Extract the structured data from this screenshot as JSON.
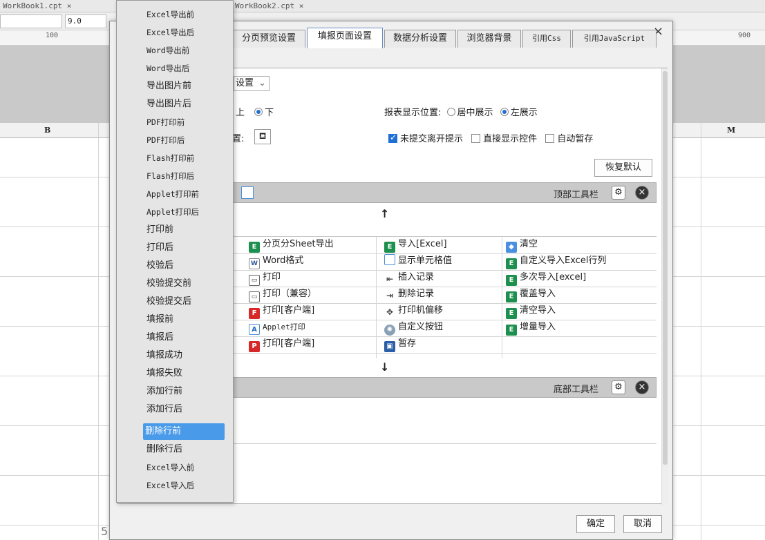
{
  "topbar": {
    "tab1": "WorkBook1.cpt ×",
    "tab2": "WorkBook2.cpt ×"
  },
  "format_bar": {
    "font_size": "9.0"
  },
  "ruler": {
    "mark_left": "100",
    "mark_right": "900"
  },
  "columns": {
    "b": "B",
    "m": "M"
  },
  "row_number_partial": "5",
  "dialog": {
    "close": "×",
    "tabs": [
      "分页预览设置",
      "填报页面设置",
      "数据分析设置",
      "浏览器背景",
      "引用Css",
      "引用JavaScript"
    ],
    "setting_select": "设置",
    "position_label": "上",
    "position_label_2": "下",
    "display_pos_label": "报表显示位置:",
    "display_center": "居中展示",
    "display_left": "左展示",
    "pos_label_3": "置:",
    "checkboxes": [
      "未提交离开提示",
      "直接显示控件",
      "自动暂存"
    ],
    "restore_default": "恢复默认",
    "top_toolbar_label": "顶部工具栏",
    "bottom_toolbar_label": "底部工具栏",
    "arrow_up": "↑",
    "arrow_down": "↓",
    "toolbar_items": [
      [
        "分页分Sheet导出",
        "导入[Excel]",
        "清空"
      ],
      [
        "Word格式",
        "显示单元格值",
        "自定义导入Excel行列"
      ],
      [
        "打印",
        "插入记录",
        "多次导入[excel]"
      ],
      [
        "打印（兼容）",
        "删除记录",
        "覆盖导入"
      ],
      [
        "打印[客户端]",
        "打印机偏移",
        "清空导入"
      ],
      [
        "Applet打印",
        "自定义按钮",
        "增量导入"
      ],
      [
        "打印[客户端]",
        "暂存",
        ""
      ]
    ],
    "ok": "确定",
    "cancel": "取消"
  },
  "menu": {
    "items": [
      "Excel导出前",
      "Excel导出后",
      "Word导出前",
      "Word导出后",
      "导出图片前",
      "导出图片后",
      "PDF打印前",
      "PDF打印后",
      "Flash打印前",
      "Flash打印后",
      "Applet打印前",
      "Applet打印后",
      "打印前",
      "打印后",
      "校验后",
      "校验提交前",
      "校验提交后",
      "填报前",
      "填报后",
      "填报成功",
      "填报失败",
      "添加行前",
      "添加行后",
      "删除行前",
      "删除行后",
      "Excel导入前",
      "Excel导入后"
    ],
    "selected": "删除行前"
  }
}
